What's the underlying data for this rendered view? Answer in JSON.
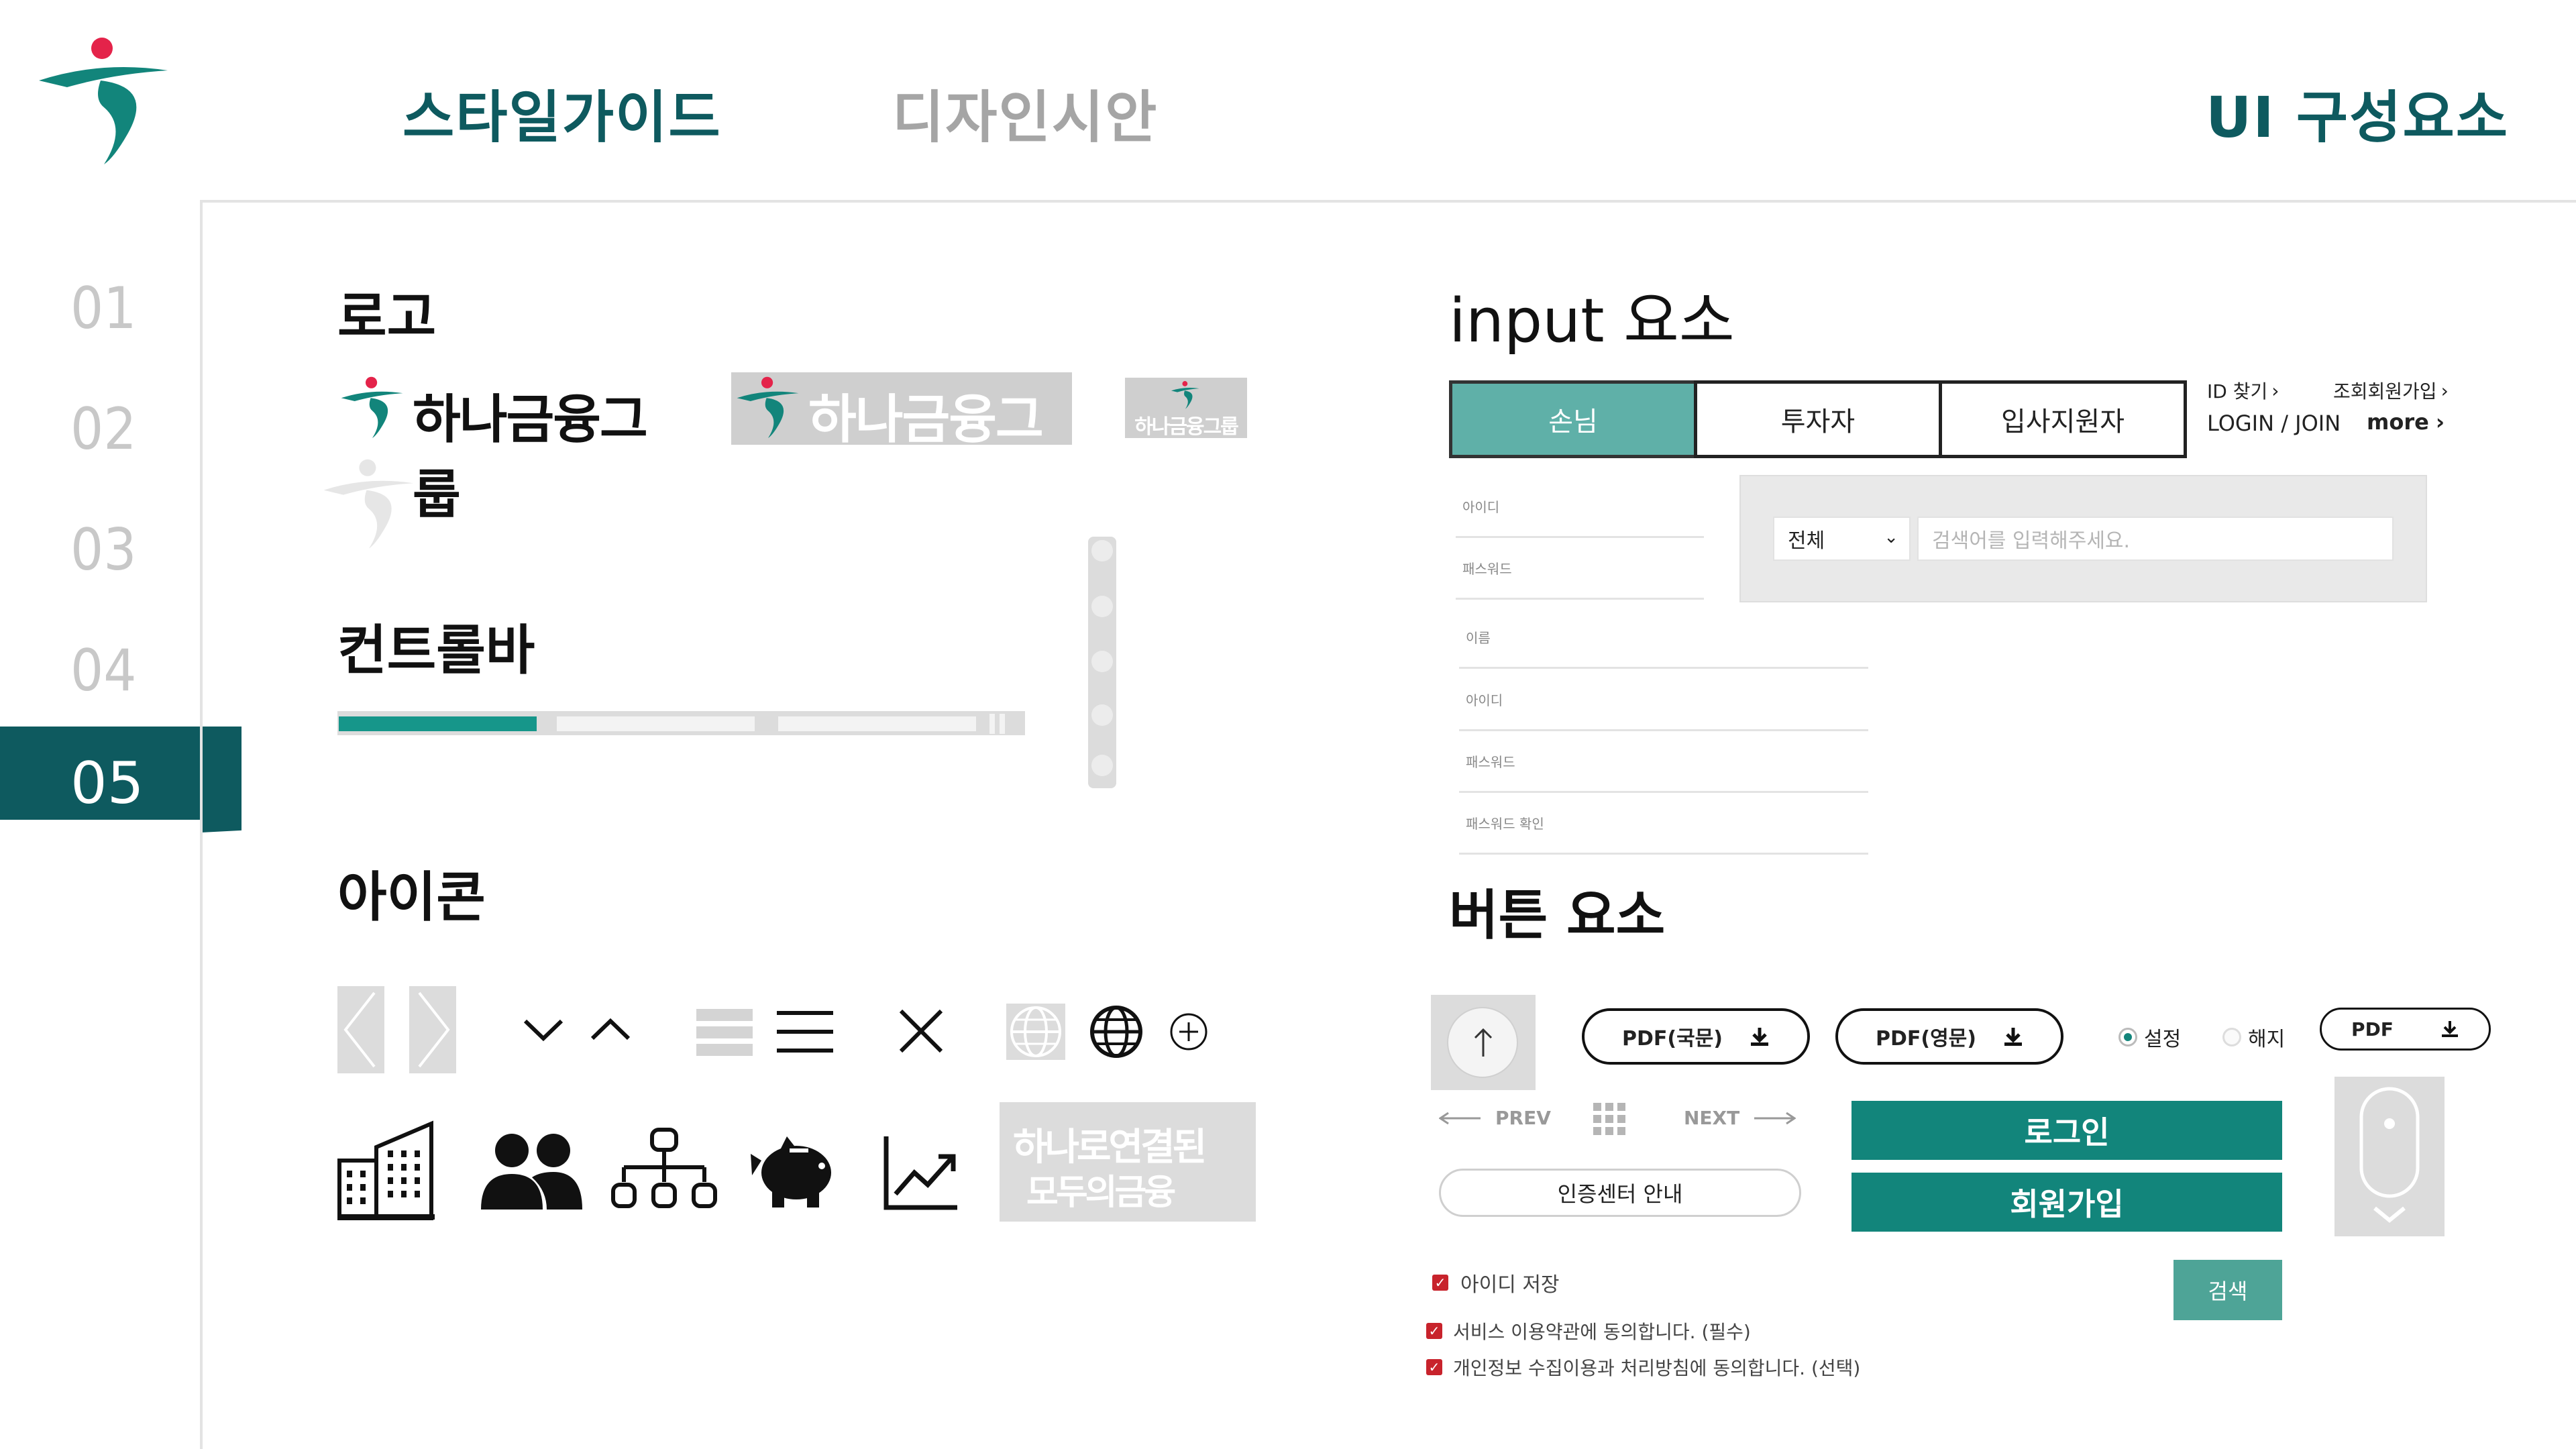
{
  "header": {
    "nav": [
      "스타일가이드",
      "디자인시안",
      "UI 구성요소"
    ]
  },
  "sidebar": {
    "items": [
      "01",
      "02",
      "03",
      "04",
      "05"
    ],
    "active": "05"
  },
  "sections": {
    "logo": "로고",
    "controlbar": "컨트롤바",
    "icons": "아이콘",
    "input": "input  요소",
    "button": "버튼  요소"
  },
  "logo": {
    "brand_text": "하나금융그룹",
    "slogan_line1": "하나로연결된",
    "slogan_line2": "모두의금융"
  },
  "input": {
    "tabs": [
      "손님",
      "투자자",
      "입사지원자"
    ],
    "links": {
      "find_id": "ID 찾기",
      "join": "조회회원가입",
      "login_join": "LOGIN / JOIN",
      "more": "more"
    },
    "fields_a": [
      "아이디",
      "패스워드"
    ],
    "fields_b": [
      "이름",
      "아이디",
      "패스워드",
      "패스워드 확인"
    ],
    "search": {
      "select_value": "전체",
      "placeholder": "검색어를 입력해주세요."
    }
  },
  "buttons": {
    "pdf_kr": "PDF(국문)",
    "pdf_en": "PDF(영문)",
    "radio_on": "설정",
    "radio_off": "해지",
    "pdf": "PDF",
    "prev": "PREV",
    "next": "NEXT",
    "login": "로그인",
    "signup": "회원가입",
    "cert": "인증센터 안내",
    "search": "검색"
  },
  "checks": {
    "save_id": "아이디 저장",
    "terms": "서비스 이용약관에 동의합니다. (필수)",
    "privacy": "개인정보 수집이용과 처리방침에 동의합니다. (선택)"
  },
  "colors": {
    "primary": "#0e5a5f",
    "accent": "#12857b",
    "red": "#e4234a"
  }
}
